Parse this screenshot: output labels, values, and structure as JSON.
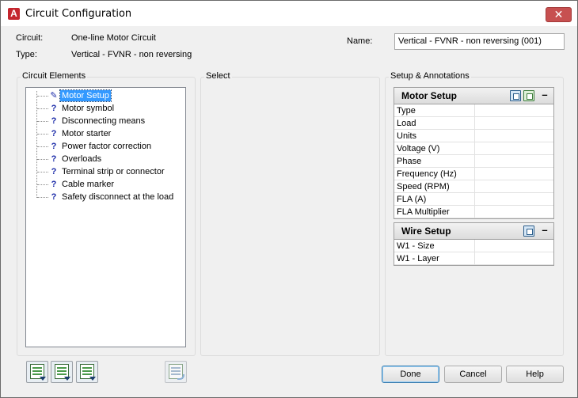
{
  "window": {
    "title": "Circuit Configuration",
    "close_glyph": "✕",
    "app_icon": "autocad-icon"
  },
  "header": {
    "circuit_label": "Circuit:",
    "circuit_value": "One-line Motor Circuit",
    "type_label": "Type:",
    "type_value": "Vertical - FVNR - non reversing",
    "name_label": "Name:",
    "name_value": "Vertical - FVNR - non reversing (001)"
  },
  "groups": {
    "circuit_elements": "Circuit Elements",
    "select": "Select",
    "setup": "Setup & Annotations"
  },
  "tree": {
    "items": [
      {
        "icon": "✎",
        "label": "Motor Setup",
        "selected": true
      },
      {
        "icon": "?",
        "label": "Motor symbol"
      },
      {
        "icon": "?",
        "label": "Disconnecting means"
      },
      {
        "icon": "?",
        "label": "Motor starter"
      },
      {
        "icon": "?",
        "label": "Power factor correction"
      },
      {
        "icon": "?",
        "label": "Overloads"
      },
      {
        "icon": "?",
        "label": "Terminal strip or connector"
      },
      {
        "icon": "?",
        "label": "Cable marker"
      },
      {
        "icon": "?",
        "label": "Safety disconnect at the load"
      }
    ]
  },
  "motor_setup": {
    "title": "Motor Setup",
    "collapse": "–",
    "rows": [
      "Type",
      "Load",
      "Units",
      "Voltage (V)",
      "Phase",
      "Frequency (Hz)",
      "Speed (RPM)",
      "FLA (A)",
      "FLA Multiplier"
    ]
  },
  "wire_setup": {
    "title": "Wire Setup",
    "collapse": "–",
    "rows": [
      "W1 - Size",
      "W1 - Layer"
    ]
  },
  "buttons": {
    "done": "Done",
    "cancel": "Cancel",
    "help": "Help"
  }
}
